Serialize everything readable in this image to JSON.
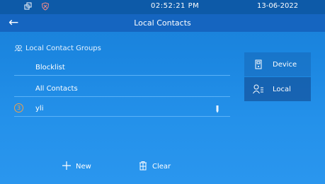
{
  "status_bar": {
    "time": "02:52:21   PM",
    "date": "13-06-2022"
  },
  "header": {
    "title": "Local Contacts"
  },
  "groups": {
    "heading": "Local Contact Groups"
  },
  "list": {
    "rows": [
      {
        "label": "Blocklist"
      },
      {
        "label": "All Contacts"
      },
      {
        "label": "yli",
        "badge": "3"
      }
    ]
  },
  "side_panel": {
    "device_label": "Device",
    "local_label": "Local"
  },
  "bottom": {
    "new_label": "New",
    "clear_label": "Clear"
  }
}
